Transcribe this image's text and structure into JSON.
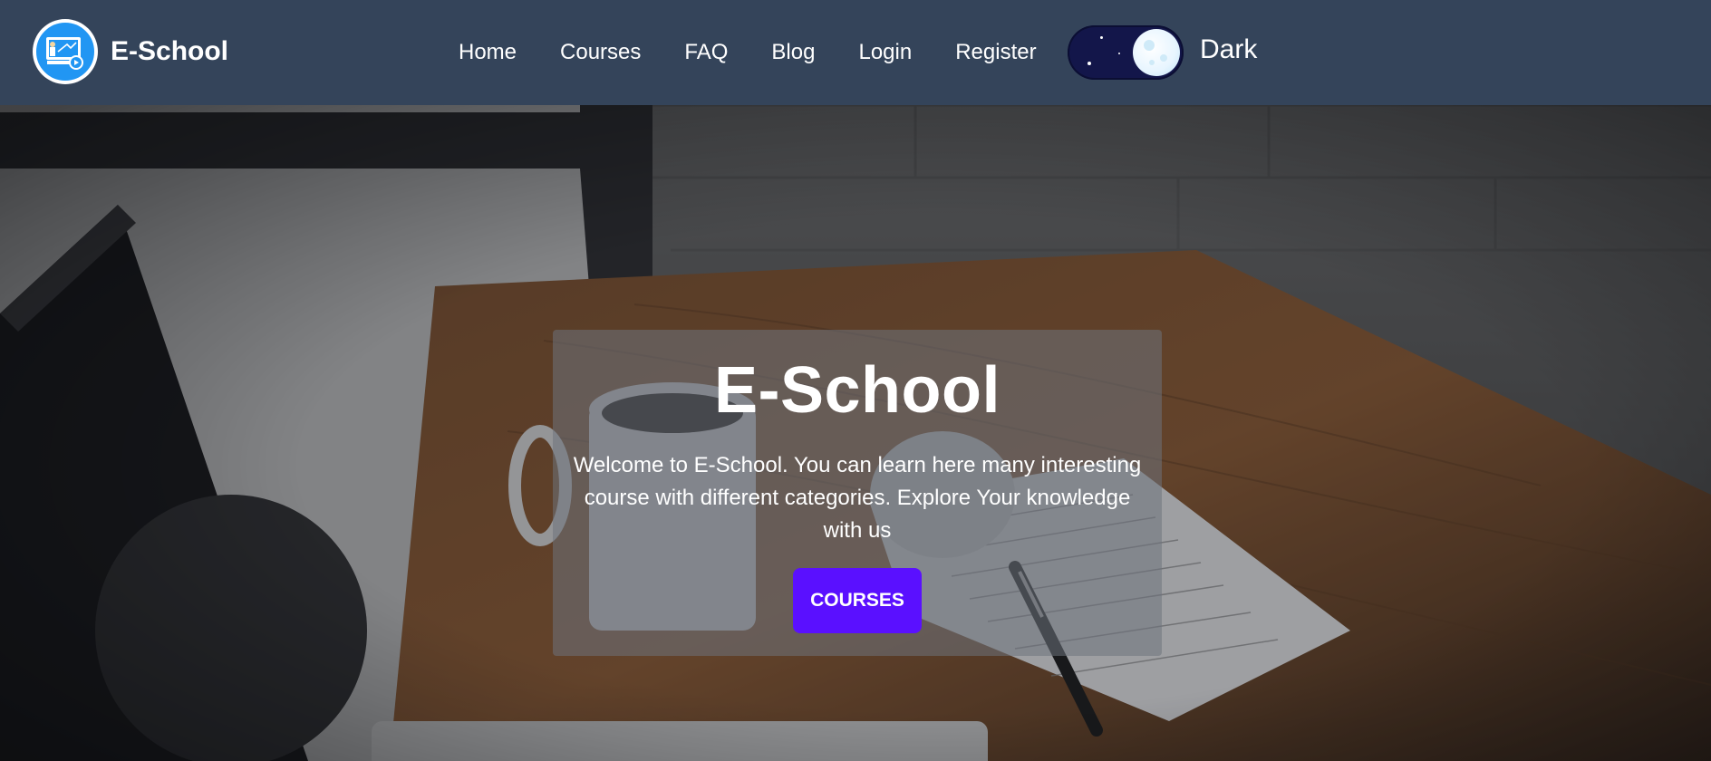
{
  "brand": {
    "name": "E-School",
    "logo_icon": "teacher-screen-icon"
  },
  "nav": {
    "items": [
      {
        "label": "Home"
      },
      {
        "label": "Courses"
      },
      {
        "label": "FAQ"
      },
      {
        "label": "Blog"
      },
      {
        "label": "Login"
      },
      {
        "label": "Register"
      }
    ]
  },
  "theme": {
    "label": "Dark",
    "enabled": true,
    "icon": "moon-icon"
  },
  "hero": {
    "title": "E-School",
    "text": "Welcome to E-School. You can learn here many interesting course with different categories. Explore Your knowledge with us",
    "button_label": "COURSES"
  },
  "colors": {
    "navbar": "#34445a",
    "accent_button": "#5a10ff",
    "toggle_track": "#13164a",
    "logo_blue": "#2196f3"
  }
}
